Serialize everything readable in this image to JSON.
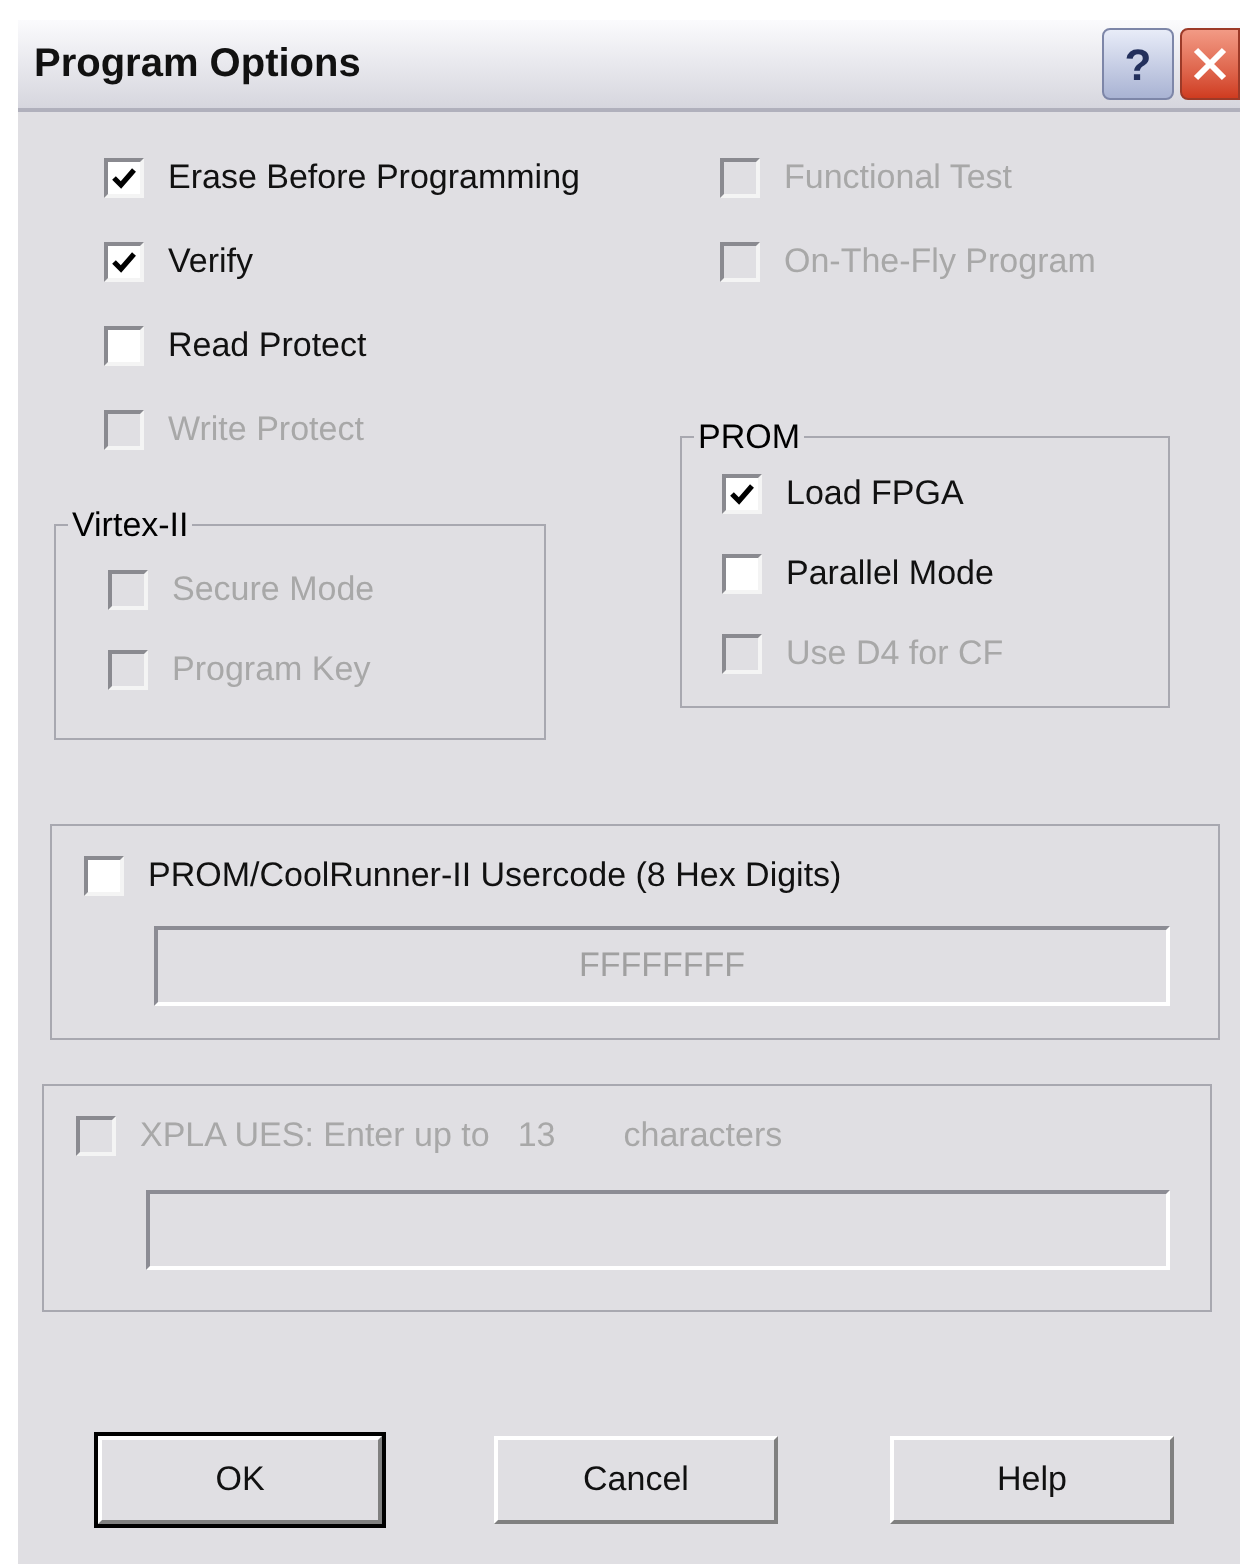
{
  "window": {
    "title": "Program Options",
    "help_button": "?"
  },
  "options": [
    {
      "label": "Erase Before Programming",
      "checked": true,
      "disabled": false
    },
    {
      "label": "Verify",
      "checked": true,
      "disabled": false
    },
    {
      "label": "Read Protect",
      "checked": false,
      "disabled": false
    },
    {
      "label": "Write Protect",
      "checked": false,
      "disabled": true
    }
  ],
  "right_options": [
    {
      "label": "Functional Test",
      "checked": false,
      "disabled": true
    },
    {
      "label": "On-The-Fly Program",
      "checked": false,
      "disabled": true
    }
  ],
  "virtex_group": {
    "title": "Virtex-II",
    "options": [
      {
        "label": "Secure Mode",
        "checked": false,
        "disabled": true
      },
      {
        "label": "Program Key",
        "checked": false,
        "disabled": true
      }
    ]
  },
  "prom_group": {
    "title": "PROM",
    "options": [
      {
        "label": "Load FPGA",
        "checked": true,
        "disabled": false
      },
      {
        "label": "Parallel Mode",
        "checked": false,
        "disabled": false
      },
      {
        "label": "Use D4 for CF",
        "checked": false,
        "disabled": true
      }
    ]
  },
  "usercode": {
    "label": "PROM/CoolRunner-II Usercode (8 Hex Digits)",
    "checked": false,
    "disabled": false,
    "field": {
      "value": "FFFFFFFF",
      "disabled": true
    }
  },
  "xpla": {
    "label": "XPLA UES: Enter up to",
    "count": "13",
    "suffix": "characters",
    "checked": false,
    "disabled": true,
    "field": {
      "disabled": true
    }
  },
  "buttons": [
    {
      "label": "OK",
      "default": true
    },
    {
      "label": "Cancel",
      "default": false
    },
    {
      "label": "Help",
      "default": false
    }
  ]
}
